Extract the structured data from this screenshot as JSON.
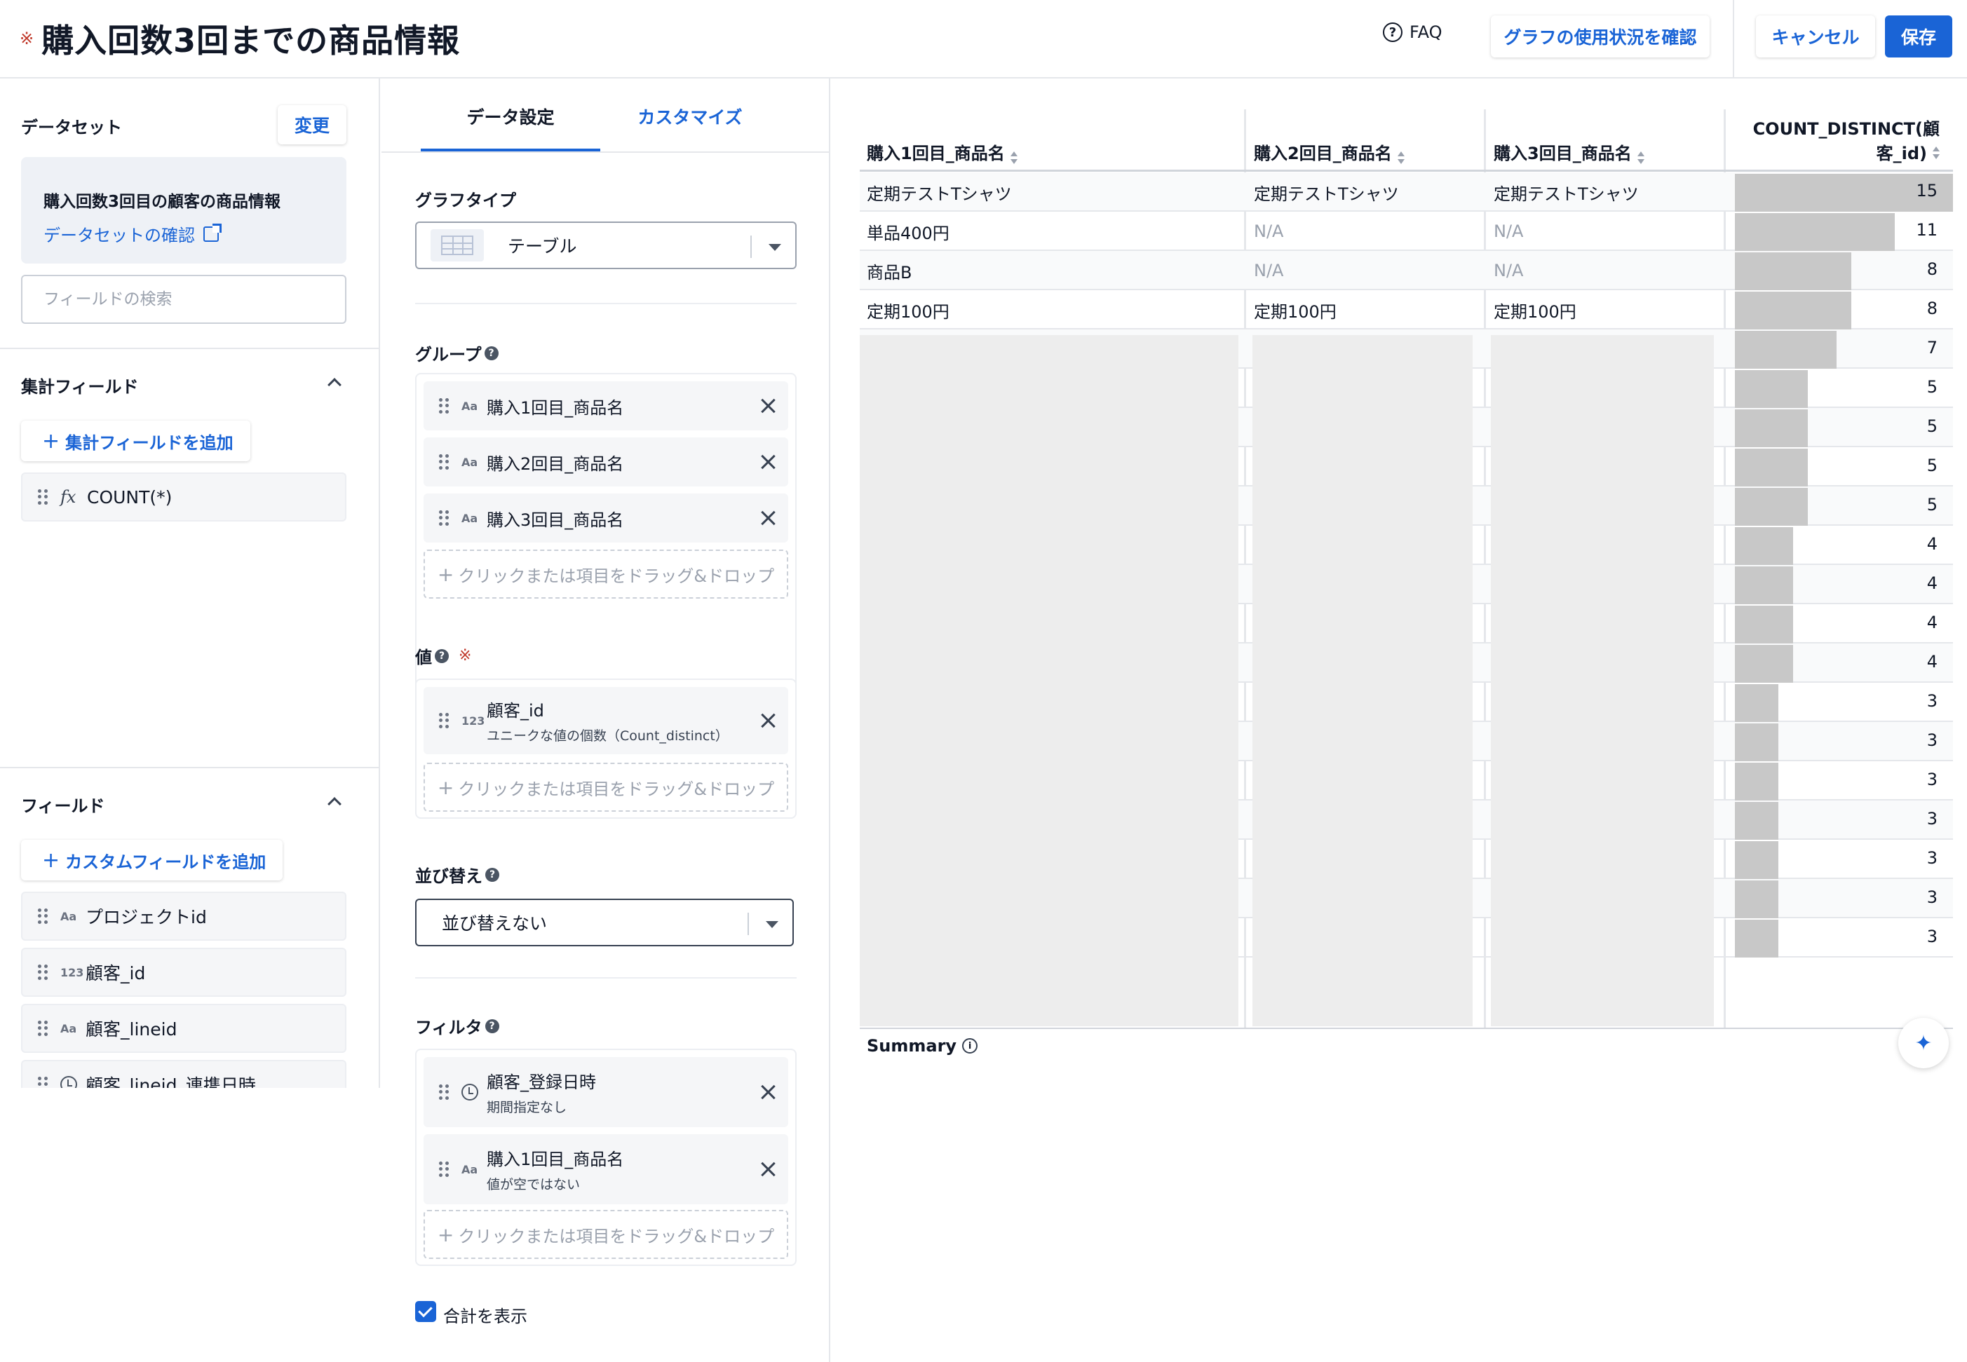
{
  "header": {
    "required_mark": "※",
    "title": "購入回数3回までの商品情報",
    "faq_label": "FAQ",
    "usage_button": "グラフの使用状況を確認",
    "cancel_button": "キャンセル",
    "save_button": "保存"
  },
  "dataset": {
    "label": "データセット",
    "change_button": "変更",
    "name": "購入回数3回目の顧客の商品情報",
    "confirm_link": "データセットの確認",
    "search_placeholder": "フィールドの検索"
  },
  "aggregate_fields": {
    "label": "集計フィールド",
    "add_button": "集計フィールドを追加",
    "items": [
      {
        "type": "fx",
        "name": "COUNT(*)"
      }
    ]
  },
  "fields": {
    "label": "フィールド",
    "add_button": "カスタムフィールドを追加",
    "items": [
      {
        "type": "Aa",
        "name": "プロジェクトid"
      },
      {
        "type": "123",
        "name": "顧客_id"
      },
      {
        "type": "Aa",
        "name": "顧客_lineid"
      },
      {
        "type": "clock",
        "name": "顧客_lineid_連携日時"
      }
    ]
  },
  "tabs": {
    "data_settings": "データ設定",
    "customize": "カスタマイズ"
  },
  "settings": {
    "graph_type_label": "グラフタイプ",
    "graph_type_value": "テーブル",
    "group_label": "グループ",
    "group_items": [
      "購入1回目_商品名",
      "購入2回目_商品名",
      "購入3回目_商品名"
    ],
    "dropzone_text": "クリックまたは項目をドラッグ&ドロップ",
    "value_label": "値",
    "required_mark": "※",
    "value_item": {
      "name": "顧客_id",
      "sub": "ユニークな値の個数（Count_distinct）"
    },
    "sort_label": "並び替え",
    "sort_value": "並び替えない",
    "filter_label": "フィルタ",
    "filter_items": [
      {
        "name": "顧客_登録日時",
        "sub": "期間指定なし"
      },
      {
        "name": "購入1回目_商品名",
        "sub": "値が空ではない"
      }
    ],
    "show_total_label": "合計を表示",
    "show_total_checked": true
  },
  "table": {
    "headers": [
      "購入1回目_商品名",
      "購入2回目_商品名",
      "購入3回目_商品名",
      "COUNT_DISTINCT(顧",
      "客_id)"
    ],
    "max_value": 15,
    "rows": [
      {
        "c1": "定期テストTシャツ",
        "c2": "定期テストTシャツ",
        "c3": "定期テストTシャツ",
        "count": "15"
      },
      {
        "c1": "単品400円",
        "c2": "N/A",
        "c3": "N/A",
        "count": "11"
      },
      {
        "c1": "商品B",
        "c2": "N/A",
        "c3": "N/A",
        "count": "8"
      },
      {
        "c1": "定期100円",
        "c2": "定期100円",
        "c3": "定期100円",
        "count": "8"
      }
    ],
    "blurred_counts": [
      "7",
      "5",
      "5",
      "5",
      "5",
      "4",
      "4",
      "4",
      "4",
      "3",
      "3",
      "3",
      "3",
      "3",
      "3",
      "3"
    ],
    "summary_label": "Summary"
  }
}
